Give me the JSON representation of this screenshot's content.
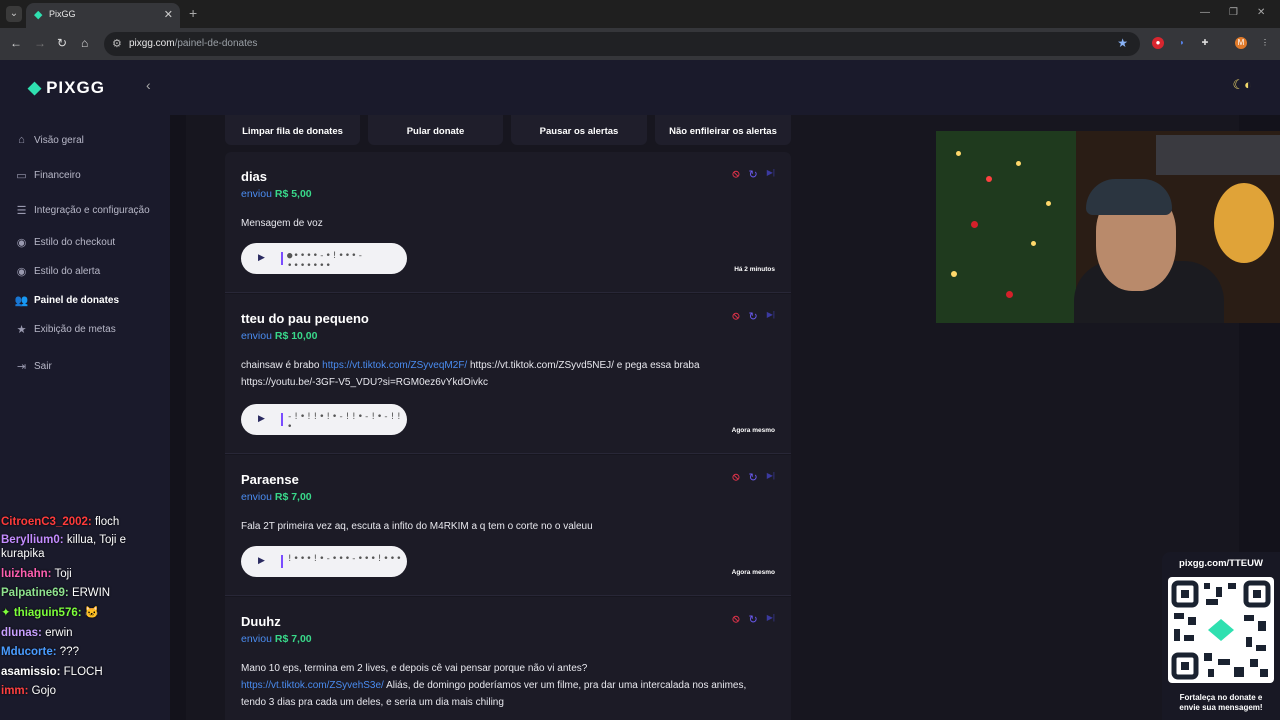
{
  "browser": {
    "tab_title": "PixGG",
    "url_domain": "pixgg.com",
    "url_path": "/painel-de-donates",
    "profile_initial": "M"
  },
  "sidebar": {
    "logo": "PIXGG",
    "items": [
      {
        "label": "Visão geral",
        "icon": "home-icon",
        "active": false
      },
      {
        "label": "Financeiro",
        "icon": "wallet-icon",
        "active": false
      },
      {
        "label": "Integração e configuração",
        "icon": "document-icon",
        "active": false
      },
      {
        "label": "Estilo do checkout",
        "icon": "palette-icon",
        "active": false
      },
      {
        "label": "Estilo do alerta",
        "icon": "palette-icon",
        "active": false
      },
      {
        "label": "Painel de donates",
        "icon": "people-icon",
        "active": true
      },
      {
        "label": "Exibição de metas",
        "icon": "star-icon",
        "active": false
      },
      {
        "label": "Sair",
        "icon": "logout-icon",
        "active": false
      }
    ]
  },
  "actions": {
    "clear_queue": "Limpar fila de donates",
    "skip": "Pular donate",
    "pause": "Pausar os alertas",
    "no_queue": "Não enfileirar os alertas"
  },
  "donations": [
    {
      "name": "dias",
      "sent_prefix": "enviou",
      "amount": "R$ 5,00",
      "message": "Mensagem de voz",
      "time": "Há 2 minutos"
    },
    {
      "name": "tteu do pau pequeno",
      "sent_prefix": "enviou",
      "amount": "R$ 10,00",
      "message_pre": "chainsaw é brabo ",
      "message_link": "https://vt.tiktok.com/ZSyveqM2F/",
      "message_post": " https://vt.tiktok.com/ZSyvd5NEJ/ e pega essa braba https://youtu.be/-3GF-V5_VDU?si=RGM0ez6vYkdOivkc",
      "time": "Agora mesmo"
    },
    {
      "name": "Paraense",
      "sent_prefix": "enviou",
      "amount": "R$ 7,00",
      "message": "Fala 2T primeira vez aq, escuta a infito do M4RKIM a q tem o corte no o valeuu",
      "time": "Agora mesmo"
    },
    {
      "name": "Duuhz",
      "sent_prefix": "enviou",
      "amount": "R$ 7,00",
      "message_pre": "Mano 10 eps, termina em 2 lives, e depois cê vai pensar porque não vi antes?",
      "message_link": "https://vt.tiktok.com/ZSyvehS3e/",
      "message_post": " Aliás, de domingo poderíamos ver um filme, pra dar uma intercalada nos animes, tendo 3 dias pra cada um deles, e seria um dia mais chiling"
    }
  ],
  "chat": [
    {
      "user": "CitroenC3_2002:",
      "text": " floch",
      "color": "#ff3b3b"
    },
    {
      "user": "Beryllium0:",
      "text": " killua, Toji e kurapika",
      "color": "#c48cff"
    },
    {
      "user": "luizhahn:",
      "text": " Toji",
      "color": "#ff5fb0"
    },
    {
      "user": "Palpatine69:",
      "text": " ERWIN",
      "color": "#8fe38f"
    },
    {
      "user": "thiaguin576:",
      "text": "",
      "color": "#7dff3b"
    },
    {
      "user": "dlunas:",
      "text": " erwin",
      "color": "#c8a0ff"
    },
    {
      "user": "Mducorte:",
      "text": " ???",
      "color": "#4a9cff"
    },
    {
      "user": "asamissio:",
      "text": " FLOCH",
      "color": "#ffffff"
    },
    {
      "user": "imm:",
      "text": " Gojo",
      "color": "#ff4040"
    }
  ],
  "qr": {
    "url": "pixgg.com/TTEUW",
    "caption_1": "Fortaleça no donate e",
    "caption_2": "envie sua mensagem!"
  }
}
